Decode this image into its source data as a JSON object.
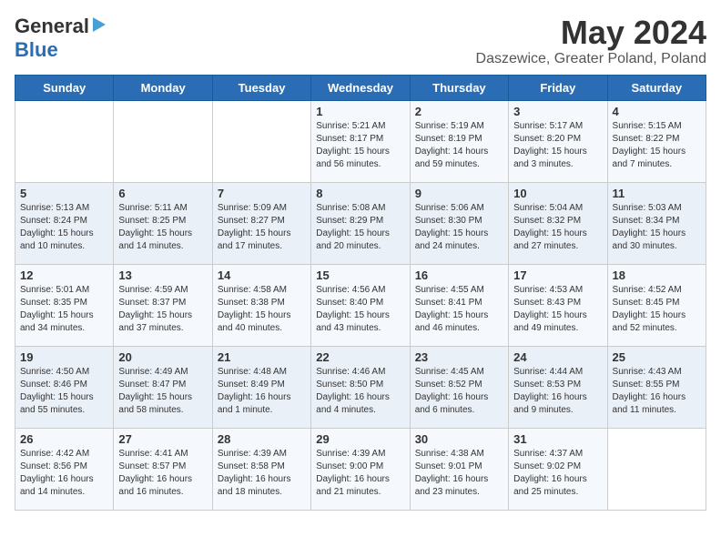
{
  "logo": {
    "general": "General",
    "blue": "Blue"
  },
  "title": "May 2024",
  "subtitle": "Daszewice, Greater Poland, Poland",
  "weekdays": [
    "Sunday",
    "Monday",
    "Tuesday",
    "Wednesday",
    "Thursday",
    "Friday",
    "Saturday"
  ],
  "weeks": [
    [
      {
        "day": "",
        "sunrise": "",
        "sunset": "",
        "daylight": ""
      },
      {
        "day": "",
        "sunrise": "",
        "sunset": "",
        "daylight": ""
      },
      {
        "day": "",
        "sunrise": "",
        "sunset": "",
        "daylight": ""
      },
      {
        "day": "1",
        "sunrise": "Sunrise: 5:21 AM",
        "sunset": "Sunset: 8:17 PM",
        "daylight": "Daylight: 15 hours and 56 minutes."
      },
      {
        "day": "2",
        "sunrise": "Sunrise: 5:19 AM",
        "sunset": "Sunset: 8:19 PM",
        "daylight": "Daylight: 14 hours and 59 minutes."
      },
      {
        "day": "3",
        "sunrise": "Sunrise: 5:17 AM",
        "sunset": "Sunset: 8:20 PM",
        "daylight": "Daylight: 15 hours and 3 minutes."
      },
      {
        "day": "4",
        "sunrise": "Sunrise: 5:15 AM",
        "sunset": "Sunset: 8:22 PM",
        "daylight": "Daylight: 15 hours and 7 minutes."
      }
    ],
    [
      {
        "day": "5",
        "sunrise": "Sunrise: 5:13 AM",
        "sunset": "Sunset: 8:24 PM",
        "daylight": "Daylight: 15 hours and 10 minutes."
      },
      {
        "day": "6",
        "sunrise": "Sunrise: 5:11 AM",
        "sunset": "Sunset: 8:25 PM",
        "daylight": "Daylight: 15 hours and 14 minutes."
      },
      {
        "day": "7",
        "sunrise": "Sunrise: 5:09 AM",
        "sunset": "Sunset: 8:27 PM",
        "daylight": "Daylight: 15 hours and 17 minutes."
      },
      {
        "day": "8",
        "sunrise": "Sunrise: 5:08 AM",
        "sunset": "Sunset: 8:29 PM",
        "daylight": "Daylight: 15 hours and 20 minutes."
      },
      {
        "day": "9",
        "sunrise": "Sunrise: 5:06 AM",
        "sunset": "Sunset: 8:30 PM",
        "daylight": "Daylight: 15 hours and 24 minutes."
      },
      {
        "day": "10",
        "sunrise": "Sunrise: 5:04 AM",
        "sunset": "Sunset: 8:32 PM",
        "daylight": "Daylight: 15 hours and 27 minutes."
      },
      {
        "day": "11",
        "sunrise": "Sunrise: 5:03 AM",
        "sunset": "Sunset: 8:34 PM",
        "daylight": "Daylight: 15 hours and 30 minutes."
      }
    ],
    [
      {
        "day": "12",
        "sunrise": "Sunrise: 5:01 AM",
        "sunset": "Sunset: 8:35 PM",
        "daylight": "Daylight: 15 hours and 34 minutes."
      },
      {
        "day": "13",
        "sunrise": "Sunrise: 4:59 AM",
        "sunset": "Sunset: 8:37 PM",
        "daylight": "Daylight: 15 hours and 37 minutes."
      },
      {
        "day": "14",
        "sunrise": "Sunrise: 4:58 AM",
        "sunset": "Sunset: 8:38 PM",
        "daylight": "Daylight: 15 hours and 40 minutes."
      },
      {
        "day": "15",
        "sunrise": "Sunrise: 4:56 AM",
        "sunset": "Sunset: 8:40 PM",
        "daylight": "Daylight: 15 hours and 43 minutes."
      },
      {
        "day": "16",
        "sunrise": "Sunrise: 4:55 AM",
        "sunset": "Sunset: 8:41 PM",
        "daylight": "Daylight: 15 hours and 46 minutes."
      },
      {
        "day": "17",
        "sunrise": "Sunrise: 4:53 AM",
        "sunset": "Sunset: 8:43 PM",
        "daylight": "Daylight: 15 hours and 49 minutes."
      },
      {
        "day": "18",
        "sunrise": "Sunrise: 4:52 AM",
        "sunset": "Sunset: 8:45 PM",
        "daylight": "Daylight: 15 hours and 52 minutes."
      }
    ],
    [
      {
        "day": "19",
        "sunrise": "Sunrise: 4:50 AM",
        "sunset": "Sunset: 8:46 PM",
        "daylight": "Daylight: 15 hours and 55 minutes."
      },
      {
        "day": "20",
        "sunrise": "Sunrise: 4:49 AM",
        "sunset": "Sunset: 8:47 PM",
        "daylight": "Daylight: 15 hours and 58 minutes."
      },
      {
        "day": "21",
        "sunrise": "Sunrise: 4:48 AM",
        "sunset": "Sunset: 8:49 PM",
        "daylight": "Daylight: 16 hours and 1 minute."
      },
      {
        "day": "22",
        "sunrise": "Sunrise: 4:46 AM",
        "sunset": "Sunset: 8:50 PM",
        "daylight": "Daylight: 16 hours and 4 minutes."
      },
      {
        "day": "23",
        "sunrise": "Sunrise: 4:45 AM",
        "sunset": "Sunset: 8:52 PM",
        "daylight": "Daylight: 16 hours and 6 minutes."
      },
      {
        "day": "24",
        "sunrise": "Sunrise: 4:44 AM",
        "sunset": "Sunset: 8:53 PM",
        "daylight": "Daylight: 16 hours and 9 minutes."
      },
      {
        "day": "25",
        "sunrise": "Sunrise: 4:43 AM",
        "sunset": "Sunset: 8:55 PM",
        "daylight": "Daylight: 16 hours and 11 minutes."
      }
    ],
    [
      {
        "day": "26",
        "sunrise": "Sunrise: 4:42 AM",
        "sunset": "Sunset: 8:56 PM",
        "daylight": "Daylight: 16 hours and 14 minutes."
      },
      {
        "day": "27",
        "sunrise": "Sunrise: 4:41 AM",
        "sunset": "Sunset: 8:57 PM",
        "daylight": "Daylight: 16 hours and 16 minutes."
      },
      {
        "day": "28",
        "sunrise": "Sunrise: 4:39 AM",
        "sunset": "Sunset: 8:58 PM",
        "daylight": "Daylight: 16 hours and 18 minutes."
      },
      {
        "day": "29",
        "sunrise": "Sunrise: 4:39 AM",
        "sunset": "Sunset: 9:00 PM",
        "daylight": "Daylight: 16 hours and 21 minutes."
      },
      {
        "day": "30",
        "sunrise": "Sunrise: 4:38 AM",
        "sunset": "Sunset: 9:01 PM",
        "daylight": "Daylight: 16 hours and 23 minutes."
      },
      {
        "day": "31",
        "sunrise": "Sunrise: 4:37 AM",
        "sunset": "Sunset: 9:02 PM",
        "daylight": "Daylight: 16 hours and 25 minutes."
      },
      {
        "day": "",
        "sunrise": "",
        "sunset": "",
        "daylight": ""
      }
    ]
  ]
}
